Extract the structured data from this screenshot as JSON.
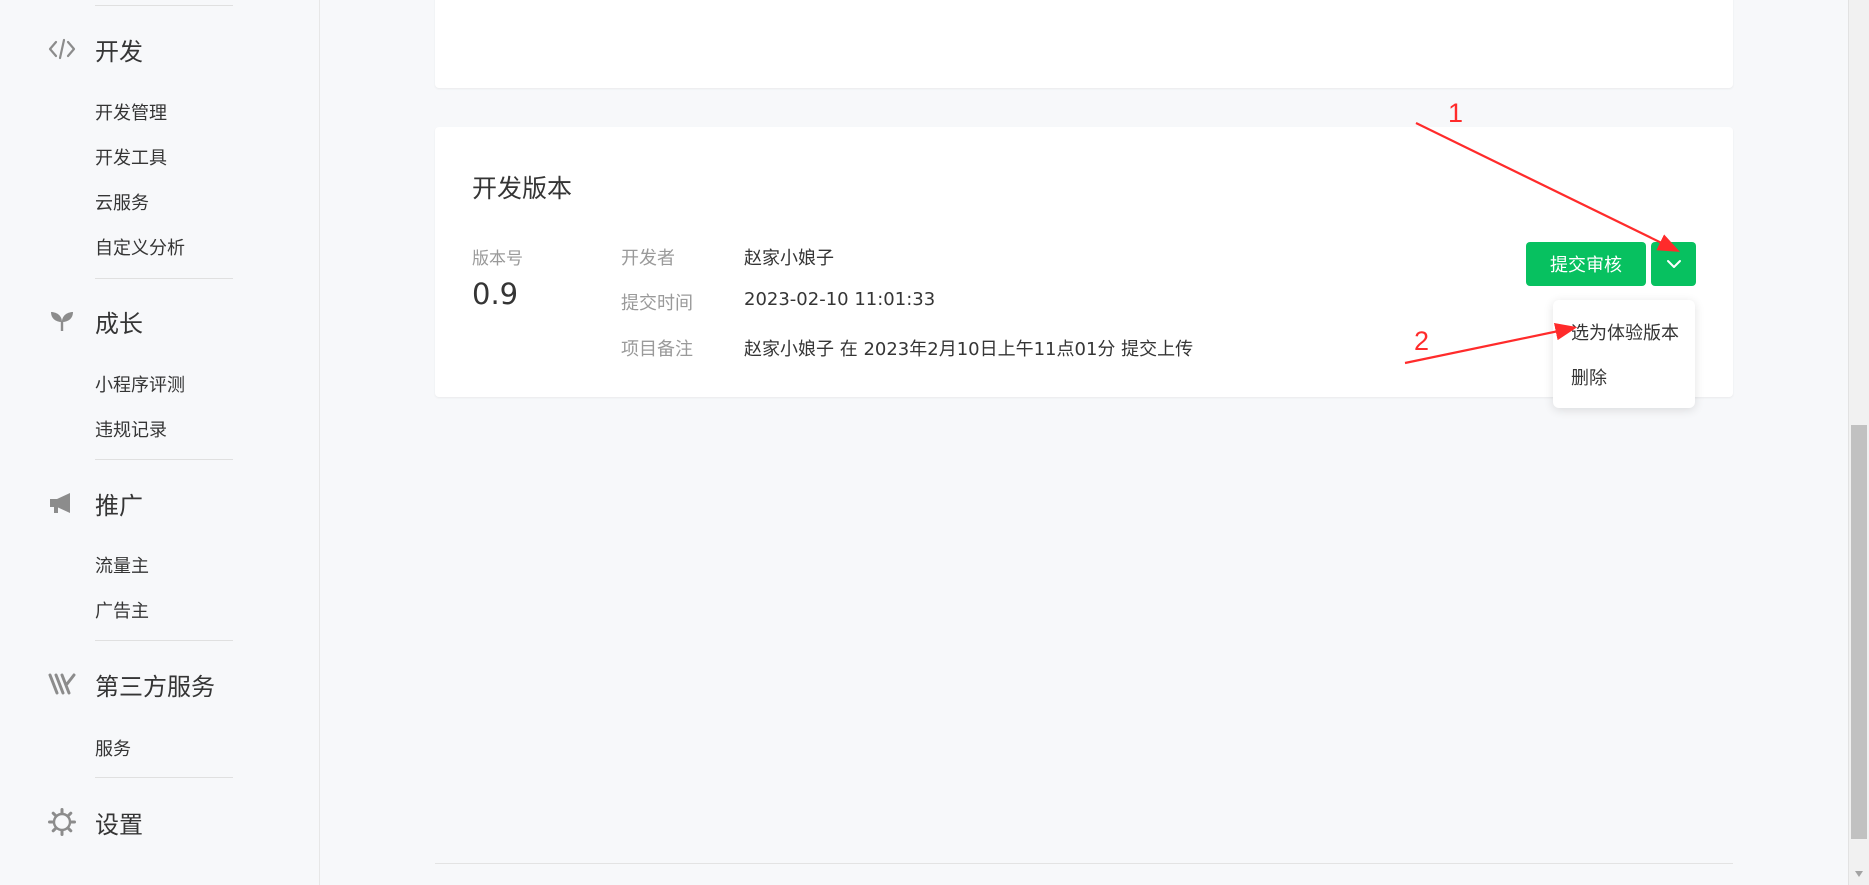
{
  "sidebar": {
    "groups": [
      {
        "label": "开发",
        "icon": "code-icon",
        "items": [
          "开发管理",
          "开发工具",
          "云服务",
          "自定义分析"
        ]
      },
      {
        "label": "成长",
        "icon": "sprout-icon",
        "items": [
          "小程序评测",
          "违规记录"
        ]
      },
      {
        "label": "推广",
        "icon": "megaphone-icon",
        "items": [
          "流量主",
          "广告主"
        ]
      },
      {
        "label": "第三方服务",
        "icon": "third-party-icon",
        "items": [
          "服务"
        ]
      },
      {
        "label": "设置",
        "icon": "gear-icon",
        "items": []
      }
    ]
  },
  "dev_version": {
    "title": "开发版本",
    "version_label": "版本号",
    "version_value": "0.9",
    "developer_label": "开发者",
    "developer_value": "赵家小娘子",
    "submit_time_label": "提交时间",
    "submit_time_value": "2023-02-10 11:01:33",
    "note_label": "项目备注",
    "note_value": "赵家小娘子 在 2023年2月10日上午11点01分 提交上传",
    "submit_button": "提交审核",
    "dropdown_icon": "chevron-down-icon",
    "dropdown_items": [
      "选为体验版本",
      "删除"
    ]
  },
  "annotations": {
    "arrow1_number": "1",
    "arrow2_number": "2",
    "color": "#ff2b2b"
  },
  "colors": {
    "primary": "#07c160",
    "background": "#f7f8fa",
    "card": "#ffffff"
  }
}
